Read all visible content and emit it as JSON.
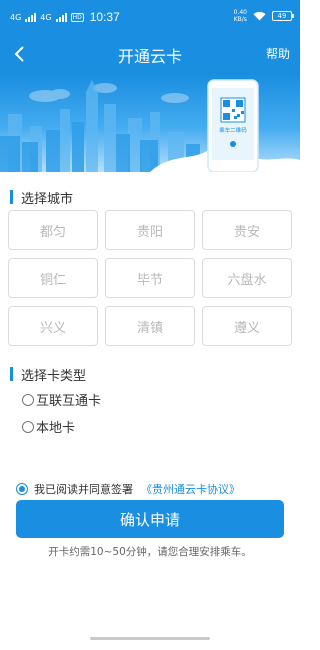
{
  "status_bar": {
    "signal1": "4G",
    "signal2": "4G",
    "hd": "HD",
    "time": "10:37",
    "speed_value": "0.40",
    "speed_unit": "KB/s",
    "battery": "49"
  },
  "nav": {
    "title": "开通云卡",
    "help": "帮助"
  },
  "banner": {
    "phone_caption": "乘车二维码"
  },
  "city_section": {
    "title": "选择城市",
    "cities": [
      "都匀",
      "贵阳",
      "贵安",
      "铜仁",
      "毕节",
      "六盘水",
      "兴义",
      "清镇",
      "遵义"
    ]
  },
  "card_section": {
    "title": "选择卡类型",
    "options": [
      "互联互通卡",
      "本地卡"
    ]
  },
  "agreement": {
    "text": "我已阅读并同意签署",
    "link": "《贵州通云卡协议》"
  },
  "confirm_button": "确认申请",
  "note": "开卡约需10~50分钟，请您合理安排乘车。",
  "colors": {
    "primary": "#1a8ee0",
    "border": "#dcdcdc",
    "disabled_text": "#b8b8b8"
  }
}
